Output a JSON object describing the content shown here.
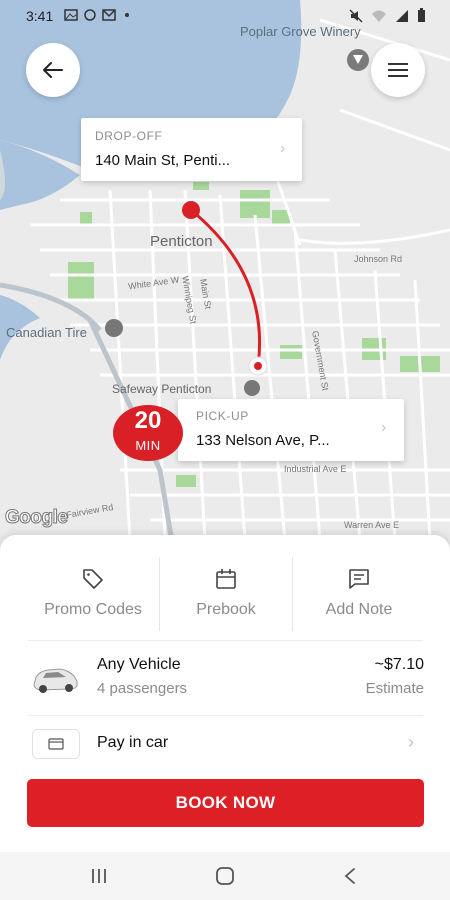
{
  "status_bar": {
    "time": "3:41",
    "left_icons": [
      "image-icon",
      "sync-icon",
      "gmail-icon",
      "dot-icon"
    ],
    "right_icons": [
      "mute-icon",
      "wifi-icon",
      "signal-icon",
      "battery-icon"
    ]
  },
  "map": {
    "place_labels": {
      "winery": "Poplar Grove Winery",
      "town": "Penticton",
      "canadian_tire": "Canadian Tire",
      "safeway": "Safeway Penticton",
      "johnson_rd": "Johnson Rd",
      "main_st": "Main St",
      "winnipeg_st": "Winnipeg St",
      "government_st": "Government St",
      "white_ave": "White Ave W",
      "industrial_ave": "Industrial Ave E",
      "warren_ave": "Warren Ave E",
      "fairview_rd": "Fairview Rd"
    },
    "attribution": "Google",
    "route_color": "#d92027"
  },
  "dropoff": {
    "caption": "DROP-OFF",
    "address": "140 Main St, Penti..."
  },
  "pickup": {
    "caption": "PICK-UP",
    "address": "133 Nelson Ave, P...",
    "eta_value": "20",
    "eta_unit": "MIN"
  },
  "options": [
    {
      "label": "Promo Codes",
      "icon": "tag-icon"
    },
    {
      "label": "Prebook",
      "icon": "calendar-icon"
    },
    {
      "label": "Add Note",
      "icon": "note-icon"
    }
  ],
  "vehicle": {
    "name": "Any Vehicle",
    "passengers": "4 passengers",
    "price": "~$7.10",
    "price_note": "Estimate",
    "icon": "car-icon"
  },
  "payment": {
    "label": "Pay in car",
    "icon": "card-icon"
  },
  "book_button": "BOOK NOW",
  "accent_color": "#dd1f26",
  "nav_icons": [
    "recents-icon",
    "home-icon",
    "back-icon"
  ]
}
